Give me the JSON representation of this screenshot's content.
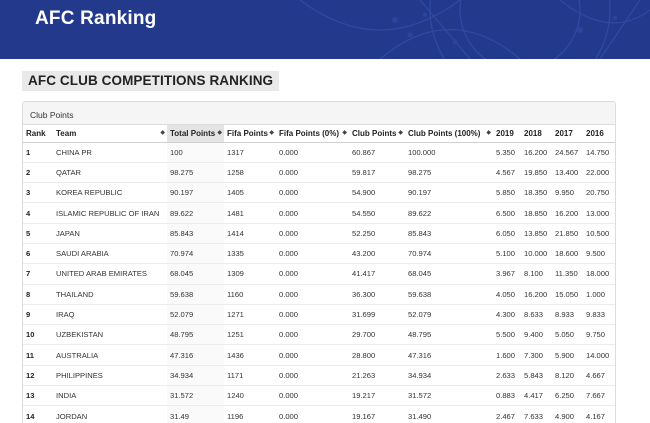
{
  "header": {
    "title": "AFC Ranking"
  },
  "section": {
    "title": "AFC CLUB COMPETITIONS RANKING"
  },
  "panel": {
    "title": "Club Points"
  },
  "table": {
    "columns": [
      "Rank",
      "Team",
      "Total Points",
      "Fifa Points",
      "Fifa Points (0%)",
      "Club Points",
      "Club Points (100%)",
      "2019",
      "2018",
      "2017",
      "2016"
    ],
    "rows": [
      [
        "1",
        "CHINA PR",
        "100",
        "1317",
        "0.000",
        "60.867",
        "100.000",
        "5.350",
        "16.200",
        "24.567",
        "14.750"
      ],
      [
        "2",
        "QATAR",
        "98.275",
        "1258",
        "0.000",
        "59.817",
        "98.275",
        "4.567",
        "19.850",
        "13.400",
        "22.000"
      ],
      [
        "3",
        "KOREA REPUBLIC",
        "90.197",
        "1405",
        "0.000",
        "54.900",
        "90.197",
        "5.850",
        "18.350",
        "9.950",
        "20.750"
      ],
      [
        "4",
        "ISLAMIC REPUBLIC OF IRAN",
        "89.622",
        "1481",
        "0.000",
        "54.550",
        "89.622",
        "6.500",
        "18.850",
        "16.200",
        "13.000"
      ],
      [
        "5",
        "JAPAN",
        "85.843",
        "1414",
        "0.000",
        "52.250",
        "85.843",
        "6.050",
        "13.850",
        "21.850",
        "10.500"
      ],
      [
        "6",
        "SAUDI ARABIA",
        "70.974",
        "1335",
        "0.000",
        "43.200",
        "70.974",
        "5.100",
        "10.000",
        "18.600",
        "9.500"
      ],
      [
        "7",
        "UNITED ARAB EMIRATES",
        "68.045",
        "1309",
        "0.000",
        "41.417",
        "68.045",
        "3.967",
        "8.100",
        "11.350",
        "18.000"
      ],
      [
        "8",
        "THAILAND",
        "59.638",
        "1160",
        "0.000",
        "36.300",
        "59.638",
        "4.050",
        "16.200",
        "15.050",
        "1.000"
      ],
      [
        "9",
        "IRAQ",
        "52.079",
        "1271",
        "0.000",
        "31.699",
        "52.079",
        "4.300",
        "8.633",
        "8.933",
        "9.833"
      ],
      [
        "10",
        "UZBEKISTAN",
        "48.795",
        "1251",
        "0.000",
        "29.700",
        "48.795",
        "5.500",
        "9.400",
        "5.050",
        "9.750"
      ],
      [
        "11",
        "AUSTRALIA",
        "47.316",
        "1436",
        "0.000",
        "28.800",
        "47.316",
        "1.600",
        "7.300",
        "5.900",
        "14.000"
      ],
      [
        "12",
        "PHILIPPINES",
        "34.934",
        "1171",
        "0.000",
        "21.263",
        "34.934",
        "2.633",
        "5.843",
        "8.120",
        "4.667"
      ],
      [
        "13",
        "INDIA",
        "31.572",
        "1240",
        "0.000",
        "19.217",
        "31.572",
        "0.883",
        "4.417",
        "6.250",
        "7.667"
      ],
      [
        "14",
        "JORDAN",
        "31.49",
        "1196",
        "0.000",
        "19.167",
        "31.490",
        "2.467",
        "7.633",
        "4.900",
        "4.167"
      ]
    ]
  },
  "colors": {
    "banner": "#233a8c",
    "sorted_header": "#e4e4e4"
  }
}
